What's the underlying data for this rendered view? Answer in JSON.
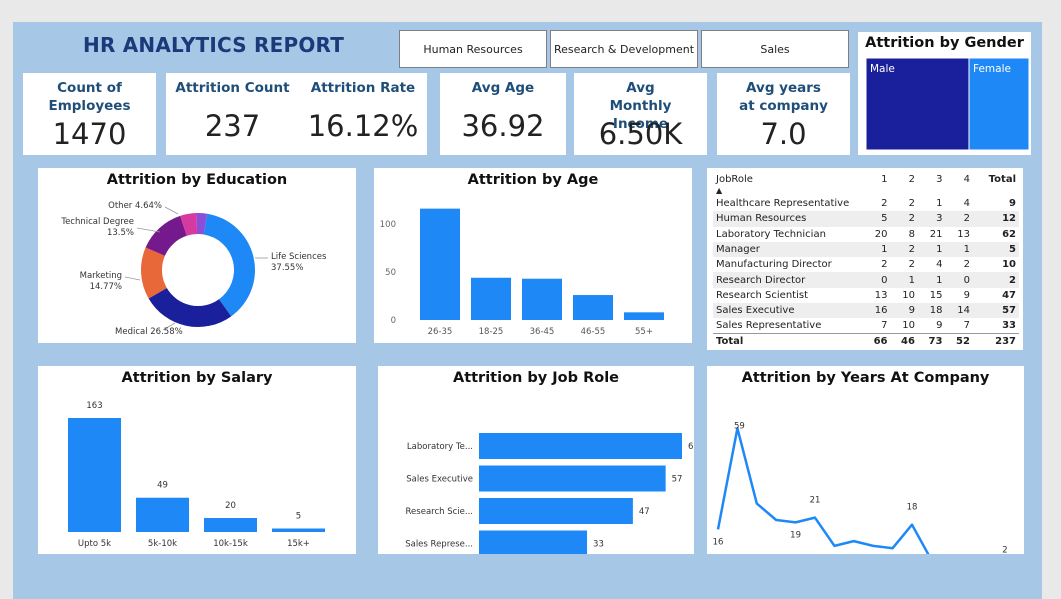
{
  "report": {
    "title": "HR ANALYTICS REPORT"
  },
  "slicers": [
    "Human Resources",
    "Research & Development",
    "Sales"
  ],
  "kpis": [
    {
      "label": "Count of Employees",
      "value": "1470"
    },
    {
      "label": "Attrition Count",
      "value": "237"
    },
    {
      "label": "Attrition Rate",
      "value": "16.12%"
    },
    {
      "label": "Avg Age",
      "value": "36.92"
    },
    {
      "label": "Avg Monthly Income",
      "value": "6.50K"
    },
    {
      "label": "Avg years at company",
      "value": "7.0"
    }
  ],
  "colors": {
    "primary": "#1e88f7",
    "dark_navy": "#1a1f9c",
    "orange": "#e8683a",
    "purple": "#741a8c",
    "pink": "#d63aa0",
    "title": "#1f4e79"
  },
  "chart_data": [
    {
      "id": "gender",
      "type": "treemap",
      "title": "Attrition by Gender",
      "categories": [
        "Male",
        "Female"
      ],
      "values": [
        150,
        87
      ]
    },
    {
      "id": "education",
      "type": "pie",
      "title": "Attrition by Education",
      "categories": [
        "Life Sciences",
        "Medical",
        "Marketing",
        "Technical Degree",
        "Other",
        "Human Resources"
      ],
      "values": [
        37.55,
        26.58,
        14.77,
        13.5,
        4.64,
        2.96
      ],
      "labels": [
        "Life Sciences 37.55%",
        "Medical 26.58%",
        "Marketing 14.77%",
        "Technical Degree 13.5%",
        "Other 4.64%",
        ""
      ]
    },
    {
      "id": "age",
      "type": "bar",
      "title": "Attrition by Age",
      "categories": [
        "26-35",
        "18-25",
        "36-45",
        "46-55",
        "55+"
      ],
      "values": [
        116,
        44,
        43,
        26,
        8
      ],
      "ylim": [
        0,
        125
      ],
      "yticks": [
        0,
        50,
        100
      ]
    },
    {
      "id": "salary",
      "type": "bar",
      "title": "Attrition by Salary",
      "categories": [
        "Upto 5k",
        "5k-10k",
        "10k-15k",
        "15k+"
      ],
      "values": [
        163,
        49,
        20,
        5
      ]
    },
    {
      "id": "jobrole",
      "type": "bar",
      "orientation": "horizontal",
      "title": "Attrition by Job Role",
      "categories": [
        "Laboratory Te...",
        "Sales Executive",
        "Research Scie...",
        "Sales Represe..."
      ],
      "values": [
        62,
        57,
        47,
        33
      ]
    },
    {
      "id": "years",
      "type": "line",
      "title": "Attrition by Years At Company",
      "x": [
        0,
        1,
        2,
        3,
        4,
        5,
        6,
        7,
        8,
        9,
        10,
        11,
        12,
        13,
        14,
        15
      ],
      "values": [
        16,
        59,
        27,
        20,
        19,
        21,
        9,
        11,
        9,
        8,
        18,
        3,
        0,
        2,
        2,
        2
      ],
      "labeled_values": [
        "16",
        "59",
        "21",
        "19",
        "9",
        "8",
        "18",
        "0",
        "2"
      ]
    },
    {
      "id": "jobrole_table",
      "type": "table",
      "columns": [
        "JobRole",
        "1",
        "2",
        "3",
        "4",
        "Total"
      ],
      "rows": [
        [
          "Healthcare Representative",
          "2",
          "2",
          "1",
          "4",
          "9"
        ],
        [
          "Human Resources",
          "5",
          "2",
          "3",
          "2",
          "12"
        ],
        [
          "Laboratory Technician",
          "20",
          "8",
          "21",
          "13",
          "62"
        ],
        [
          "Manager",
          "1",
          "2",
          "1",
          "1",
          "5"
        ],
        [
          "Manufacturing Director",
          "2",
          "2",
          "4",
          "2",
          "10"
        ],
        [
          "Research Director",
          "0",
          "1",
          "1",
          "0",
          "2"
        ],
        [
          "Research Scientist",
          "13",
          "10",
          "15",
          "9",
          "47"
        ],
        [
          "Sales Executive",
          "16",
          "9",
          "18",
          "14",
          "57"
        ],
        [
          "Sales Representative",
          "7",
          "10",
          "9",
          "7",
          "33"
        ]
      ],
      "total": [
        "Total",
        "66",
        "46",
        "73",
        "52",
        "237"
      ],
      "sort_indicator": "▲"
    }
  ]
}
